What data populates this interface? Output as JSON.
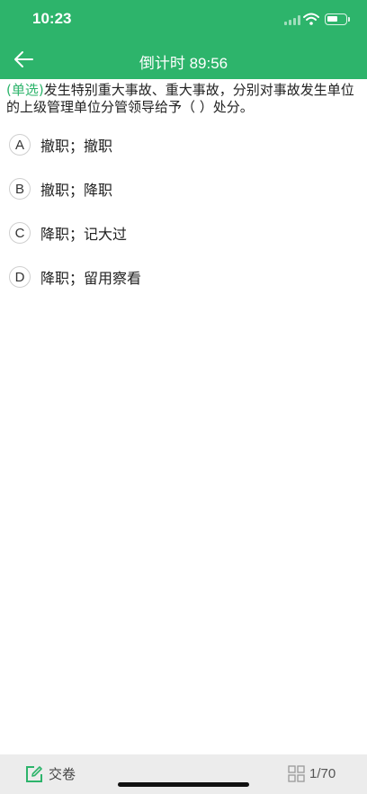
{
  "status_bar": {
    "time": "10:23"
  },
  "nav": {
    "title": "倒计时 89:56",
    "back_icon": "arrow-left-icon"
  },
  "question": {
    "type_label": "(单选)",
    "text": "发生特别重大事故、重大事故，分别对事故发生单位的上级管理单位分管领导给予（ ）处分。"
  },
  "options": [
    {
      "letter": "A",
      "text": "撤职；撤职"
    },
    {
      "letter": "B",
      "text": "撤职；降职"
    },
    {
      "letter": "C",
      "text": "降职；记大过"
    },
    {
      "letter": "D",
      "text": "降职；留用察看"
    }
  ],
  "bottom_bar": {
    "submit_label": "交卷",
    "submit_icon": "edit-icon",
    "progress": "1/70",
    "progress_icon": "grid-icon"
  },
  "colors": {
    "accent": "#2db46b",
    "bottom_bg": "#ececec"
  }
}
